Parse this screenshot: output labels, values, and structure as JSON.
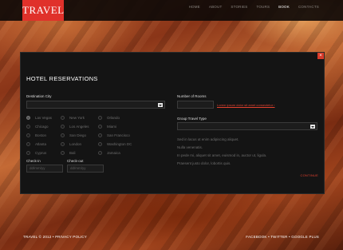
{
  "brand": {
    "logo": "TRAVEL"
  },
  "nav": [
    {
      "label": "HOME",
      "active": false
    },
    {
      "label": "ABOUT",
      "active": false
    },
    {
      "label": "STORIES",
      "active": false
    },
    {
      "label": "TOURS",
      "active": false
    },
    {
      "label": "BOOK",
      "active": true
    },
    {
      "label": "CONTACTS",
      "active": false
    }
  ],
  "modal": {
    "close": "×",
    "title": "HOTEL RESERVATIONS",
    "destination_label": "Destination City",
    "cities": [
      [
        "Las Vegas",
        "New York",
        "Orlando"
      ],
      [
        "Chicago",
        "Los Angeles",
        "Miami"
      ],
      [
        "Boston",
        "San Diego",
        "San Francisco"
      ],
      [
        "Atlanta",
        "London",
        "Washington DC"
      ],
      [
        "Cyprus",
        "Bali",
        "Jamaica"
      ]
    ],
    "checkin_label": "Check-in",
    "checkin_placeholder": "dd/mm/yy",
    "checkout_label": "Check-out",
    "checkout_placeholder": "dd/mm/yy",
    "rooms_label": "Number of Rooms",
    "rooms_link": "Lorem ipsum dolor sit amet consectetur ›",
    "group_label": "Group Travel Type",
    "paragraphs": [
      "Sed in lacus ut enim adipiscing aliquet.",
      "Nulla venenatis.",
      "In pede mi, aliquet sit amet, euismod in, auctor ut, ligula.",
      "Praesent justo dolor, lobortis quis."
    ],
    "continue": "CONTINUE"
  },
  "footer": {
    "left": "TRAVEL © 2012 • PRIVACY POLICY",
    "right": "FACEBOOK • TWITTER • GOOGLE PLUS"
  }
}
